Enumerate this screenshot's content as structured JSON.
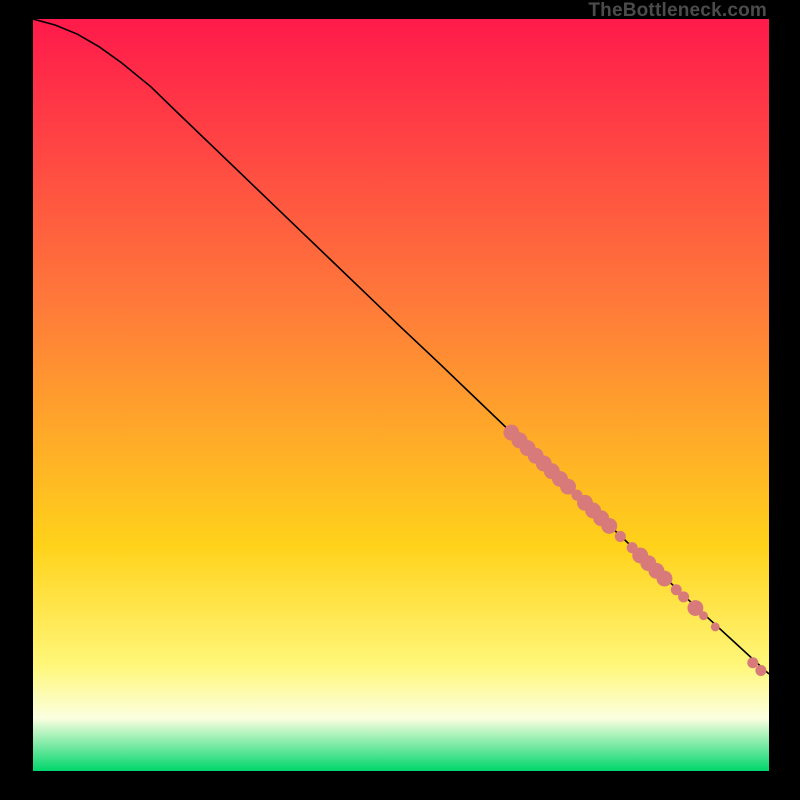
{
  "watermark": "TheBottleneck.com",
  "colors": {
    "top": "#ff1a4b",
    "mid1": "#ff7a3a",
    "mid2": "#ffd21a",
    "mid3": "#fff77a",
    "mid4": "#fbffe0",
    "bottom": "#00d66b",
    "curve": "#000000",
    "marker": "#d87a7a"
  },
  "chart_data": {
    "type": "line",
    "title": "",
    "xlabel": "",
    "ylabel": "",
    "xlim": [
      0,
      100
    ],
    "ylim": [
      0,
      100
    ],
    "curve": {
      "x": [
        0,
        3,
        6,
        9,
        12,
        16,
        20,
        25,
        30,
        35,
        40,
        45,
        50,
        55,
        60,
        65,
        70,
        75,
        80,
        85,
        90,
        95,
        100
      ],
      "y": [
        100,
        99.2,
        98.0,
        96.3,
        94.2,
        91.0,
        87.2,
        82.5,
        77.8,
        73.1,
        68.4,
        63.7,
        59.0,
        54.4,
        49.7,
        45.0,
        40.4,
        35.7,
        31.1,
        26.5,
        21.9,
        17.4,
        12.9
      ]
    },
    "markers": [
      {
        "x": 65.0,
        "y": 45.0,
        "r": 1.08
      },
      {
        "x": 66.1,
        "y": 43.97,
        "r": 1.08
      },
      {
        "x": 67.2,
        "y": 42.94,
        "r": 1.08
      },
      {
        "x": 68.3,
        "y": 41.92,
        "r": 1.08
      },
      {
        "x": 69.4,
        "y": 40.89,
        "r": 1.08
      },
      {
        "x": 70.5,
        "y": 39.86,
        "r": 1.08
      },
      {
        "x": 71.6,
        "y": 38.84,
        "r": 1.08
      },
      {
        "x": 72.7,
        "y": 37.81,
        "r": 1.08
      },
      {
        "x": 73.9,
        "y": 36.69,
        "r": 0.75
      },
      {
        "x": 75.0,
        "y": 35.66,
        "r": 1.08
      },
      {
        "x": 76.1,
        "y": 34.64,
        "r": 1.08
      },
      {
        "x": 77.2,
        "y": 33.61,
        "r": 1.08
      },
      {
        "x": 78.3,
        "y": 32.59,
        "r": 1.08
      },
      {
        "x": 79.8,
        "y": 31.19,
        "r": 0.75
      },
      {
        "x": 81.4,
        "y": 29.7,
        "r": 0.75
      },
      {
        "x": 82.5,
        "y": 28.67,
        "r": 1.08
      },
      {
        "x": 83.6,
        "y": 27.64,
        "r": 1.08
      },
      {
        "x": 84.7,
        "y": 26.62,
        "r": 1.08
      },
      {
        "x": 85.8,
        "y": 25.59,
        "r": 1.08
      },
      {
        "x": 87.4,
        "y": 24.1,
        "r": 0.75
      },
      {
        "x": 88.4,
        "y": 23.16,
        "r": 0.75
      },
      {
        "x": 90.0,
        "y": 21.67,
        "r": 1.08
      },
      {
        "x": 91.1,
        "y": 20.65,
        "r": 0.6
      },
      {
        "x": 92.7,
        "y": 19.16,
        "r": 0.6
      },
      {
        "x": 97.8,
        "y": 14.4,
        "r": 0.75
      },
      {
        "x": 98.9,
        "y": 13.37,
        "r": 0.75
      }
    ]
  }
}
